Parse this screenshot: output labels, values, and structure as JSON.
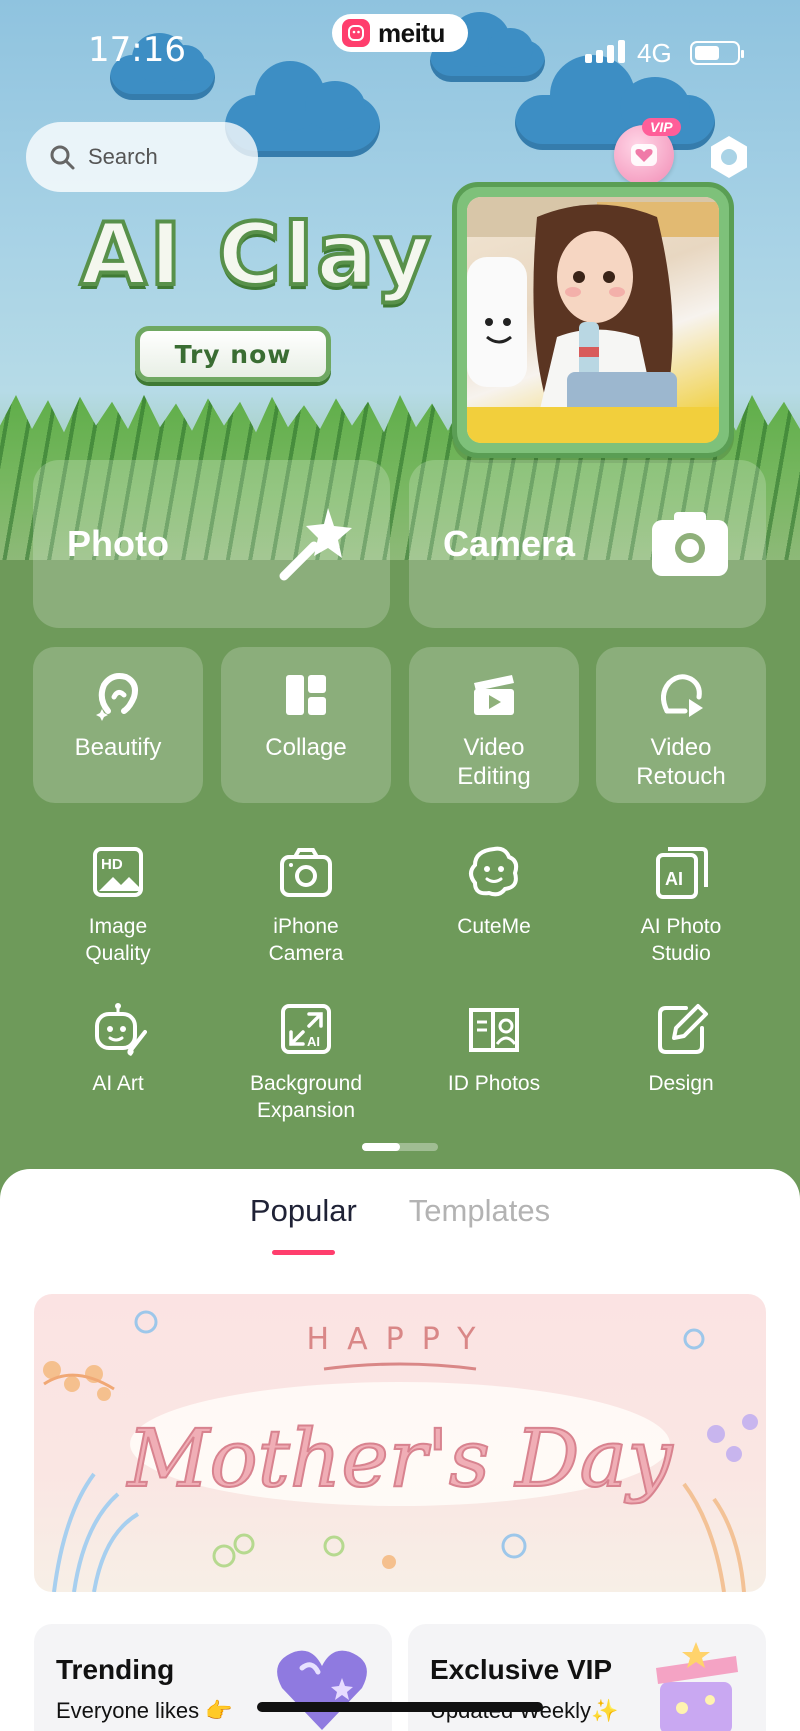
{
  "status_bar": {
    "time": "17:16",
    "network": "4G"
  },
  "brand": {
    "name": "meitu"
  },
  "search": {
    "placeholder": "Search"
  },
  "vip": {
    "tag": "VIP"
  },
  "banner": {
    "title": "AI Clay",
    "button": "Try now"
  },
  "main_tools": [
    {
      "label": "Photo",
      "icon": "magic-wand-icon"
    },
    {
      "label": "Camera",
      "icon": "camera-icon"
    }
  ],
  "quick_tools": [
    {
      "label": "Beautify",
      "icon": "beautify-icon"
    },
    {
      "label": "Collage",
      "icon": "collage-icon"
    },
    {
      "label": "Video\nEditing",
      "icon": "video-editing-icon"
    },
    {
      "label": "Video\nRetouch",
      "icon": "video-retouch-icon"
    }
  ],
  "tools": [
    {
      "label": "Image\nQuality",
      "icon": "hd-image-icon"
    },
    {
      "label": "iPhone\nCamera",
      "icon": "iphone-camera-icon"
    },
    {
      "label": "CuteMe",
      "icon": "cuteme-icon"
    },
    {
      "label": "AI Photo\nStudio",
      "icon": "ai-photo-studio-icon"
    },
    {
      "label": "AI Art",
      "icon": "ai-art-icon"
    },
    {
      "label": "Background\nExpansion",
      "icon": "background-expansion-icon"
    },
    {
      "label": "ID Photos",
      "icon": "id-photos-icon"
    },
    {
      "label": "Design",
      "icon": "design-icon"
    }
  ],
  "pager": {
    "pages": 2,
    "current": 1
  },
  "feed_tabs": [
    {
      "label": "Popular",
      "active": true
    },
    {
      "label": "Templates",
      "active": false
    }
  ],
  "promo": {
    "line1": "HAPPY",
    "line2": "Mother's Day"
  },
  "features": [
    {
      "title": "Trending",
      "subtitle": "Everyone likes 👉"
    },
    {
      "title": "Exclusive VIP",
      "subtitle": "Updated Weekly✨"
    }
  ],
  "colors": {
    "accent": "#ff3e6d",
    "panel_green": "#6e9a5a",
    "sky": "#a9d3e6"
  }
}
